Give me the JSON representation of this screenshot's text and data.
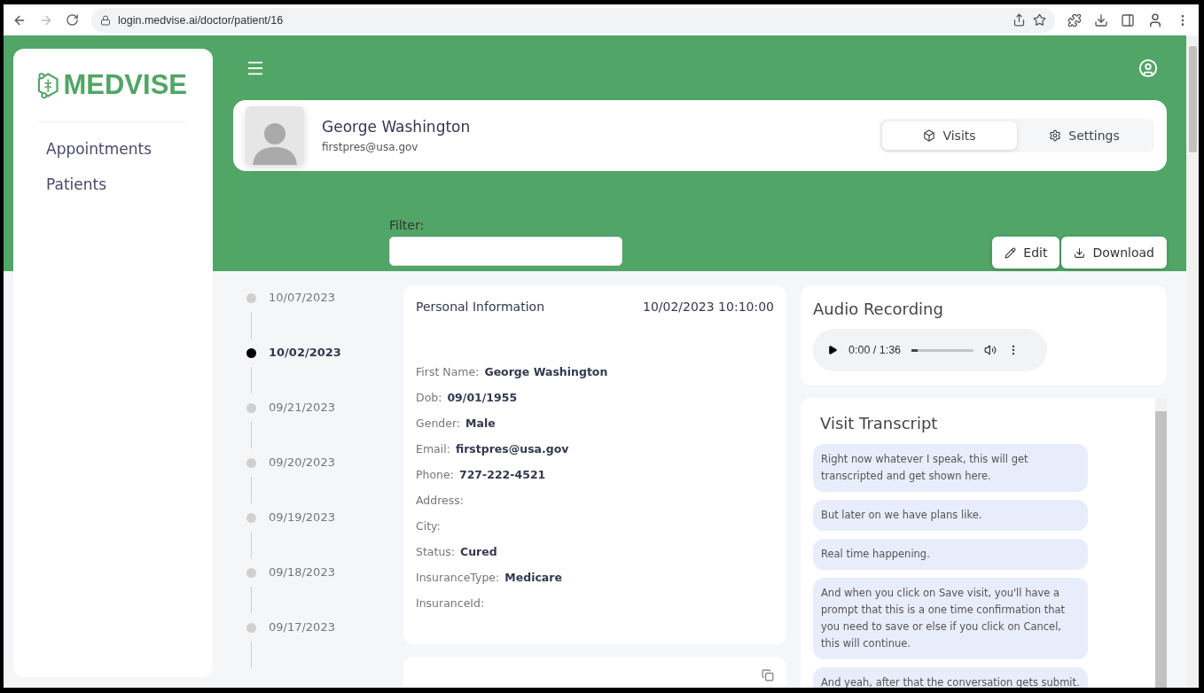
{
  "browser": {
    "url": "login.medvise.ai/doctor/patient/16"
  },
  "sidebar": {
    "logo": "MEDVISE",
    "items": [
      {
        "label": "Appointments"
      },
      {
        "label": "Patients"
      }
    ]
  },
  "profile": {
    "name": "George Washington",
    "email": "firstpres@usa.gov",
    "tabs": [
      {
        "label": "Visits",
        "selected": true
      },
      {
        "label": "Settings",
        "selected": false
      }
    ]
  },
  "filter": {
    "label": "Filter:"
  },
  "actions": [
    "Edit",
    "Download"
  ],
  "timeline": [
    {
      "date": "10/07/2023",
      "selected": false
    },
    {
      "date": "10/02/2023",
      "selected": true
    },
    {
      "date": "09/21/2023",
      "selected": false
    },
    {
      "date": "09/20/2023",
      "selected": false
    },
    {
      "date": "09/19/2023",
      "selected": false
    },
    {
      "date": "09/18/2023",
      "selected": false
    },
    {
      "date": "09/17/2023",
      "selected": false
    }
  ],
  "personal_info": {
    "title": "Personal Information",
    "timestamp": "10/02/2023 10:10:00",
    "fields": [
      {
        "label": "First Name:",
        "value": "George Washington"
      },
      {
        "label": "Dob:",
        "value": "09/01/1955"
      },
      {
        "label": "Gender:",
        "value": "Male"
      },
      {
        "label": "Email:",
        "value": "firstpres@usa.gov"
      },
      {
        "label": "Phone:",
        "value": "727-222-4521"
      },
      {
        "label": "Address:"
      },
      {
        "label": "City:"
      },
      {
        "label": "Status:",
        "value": "Cured"
      },
      {
        "label": "InsuranceType:",
        "value": "Medicare"
      },
      {
        "label": "InsuranceId:"
      }
    ]
  },
  "audio": {
    "title": "Audio Recording",
    "time": "0:00 / 1:36",
    "level": 0.1
  },
  "transcript": {
    "title": "Visit Transcript",
    "messages": [
      "Right now whatever I speak, this will get transcripted and get shown here.",
      "But later on we have plans like.",
      "Real time happening.",
      "And when you click on Save visit, you'll have a prompt that this is a one time confirmation that you need to save or else if you click on Cancel, this will continue.",
      "And yeah, after that the conversation gets submit."
    ]
  }
}
